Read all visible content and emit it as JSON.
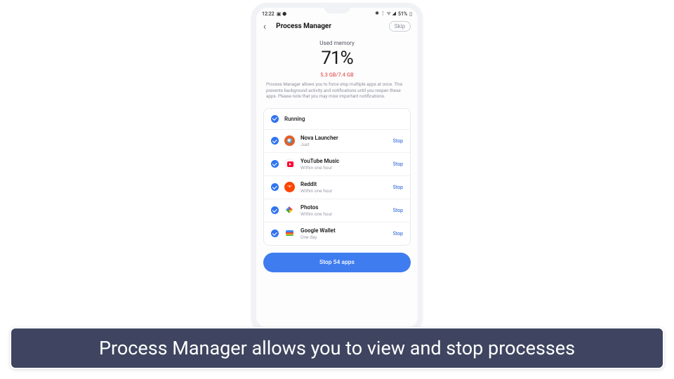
{
  "status_bar": {
    "time": "12:22",
    "left_icons": "▣ ⬢",
    "right_icons": "✱ ⋮ ᯤ ◢",
    "battery_text": "51%",
    "battery_icon": "▯"
  },
  "header": {
    "back_icon": "‹",
    "title": "Process Manager",
    "skip_label": "Skip"
  },
  "summary": {
    "label": "Used memory",
    "percent": "71%",
    "memory": "5.3 GB/7.4 GB",
    "description": "Process Manager allows you to force stop multiple apps at once. This prevents background activity and notifications until you reopen these apps. Please note that you may miss important notifications."
  },
  "list": {
    "header_label": "Running",
    "stop_link": "Stop",
    "apps": [
      {
        "name": "Nova Launcher",
        "time": "Just",
        "icon": "nova"
      },
      {
        "name": "YouTube Music",
        "time": "Within one hour",
        "icon": "yt"
      },
      {
        "name": "Reddit",
        "time": "Within one hour",
        "icon": "reddit"
      },
      {
        "name": "Photos",
        "time": "Within one hour",
        "icon": "photos"
      },
      {
        "name": "Google Wallet",
        "time": "One day",
        "icon": "wallet"
      }
    ]
  },
  "cta_label": "Stop 54 apps",
  "caption": "Process Manager allows you to view and stop processes"
}
